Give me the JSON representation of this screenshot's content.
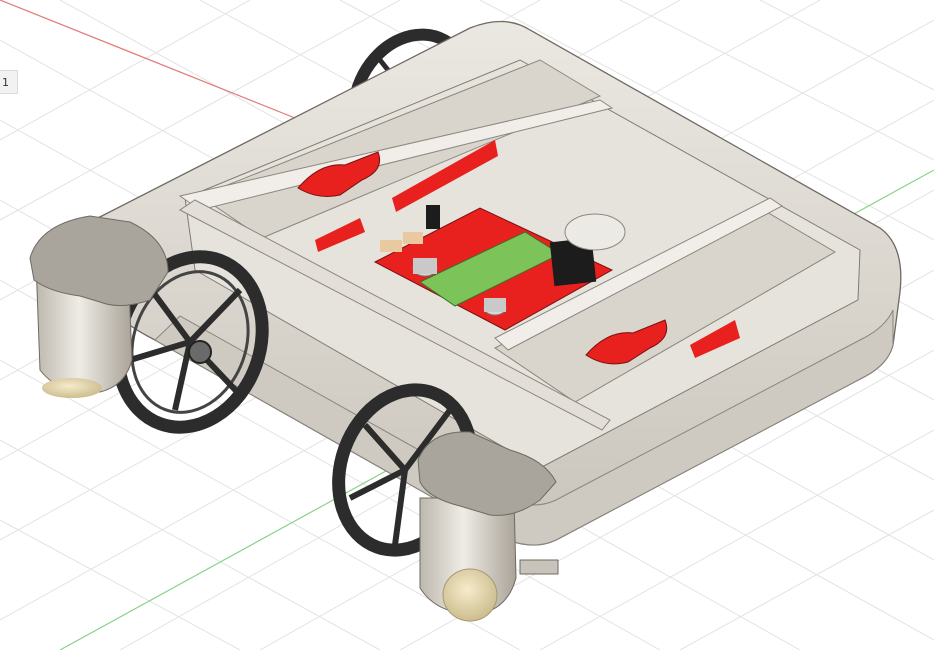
{
  "viewport": {
    "background": "#ffffff",
    "grid_color": "#e3e3e3",
    "x_axis_color": "#e27878",
    "y_axis_color": "#8ad28a"
  },
  "corner_tab": {
    "label": "1"
  },
  "model": {
    "chassis_color": "#dedad2",
    "accent_color": "#e8211f",
    "wheel_color": "#2c2c2c",
    "board_color": "#e8211f",
    "board_center_color": "#7cc35a",
    "caster_color": "#e9dcb5"
  }
}
